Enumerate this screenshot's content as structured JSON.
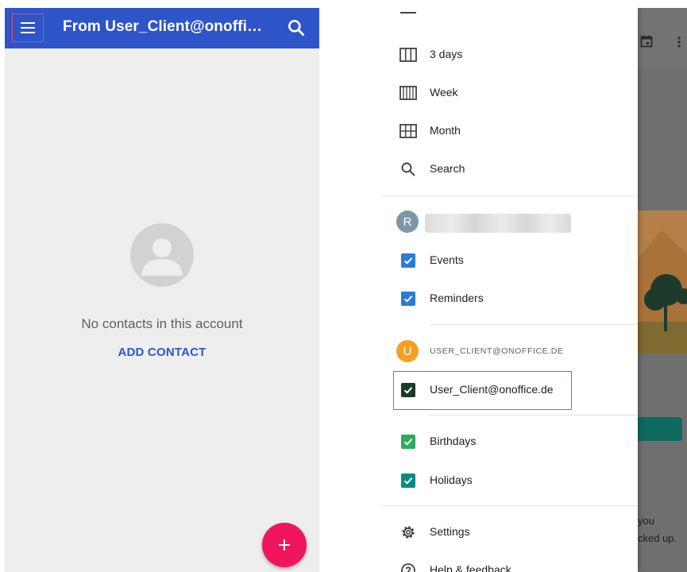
{
  "contacts": {
    "appbar": {
      "title": "From User_Client@onoffic...",
      "menu_icon": "hamburger-menu-icon",
      "search_icon": "search-icon"
    },
    "empty_state": {
      "message": "No contacts in this account",
      "action": "ADD CONTACT",
      "avatar_icon": "person-avatar-icon"
    },
    "fab": {
      "label": "+",
      "icon": "plus-icon"
    }
  },
  "calendar_drawer": {
    "views": [
      {
        "label": "3 days",
        "icon": "three-day-view-icon"
      },
      {
        "label": "Week",
        "icon": "week-view-icon"
      },
      {
        "label": "Month",
        "icon": "month-view-icon"
      },
      {
        "label": "Search",
        "icon": "search-icon"
      }
    ],
    "account_1": {
      "avatar_letter": "R",
      "calendars": [
        {
          "label": "Events",
          "checked": true
        },
        {
          "label": "Reminders",
          "checked": true
        }
      ]
    },
    "account_2": {
      "avatar_letter": "U",
      "header": "USER_CLIENT@ONOFFICE.DE",
      "calendars": [
        {
          "label": "User_Client@onoffice.de",
          "checked": true
        }
      ]
    },
    "other_calendars": [
      {
        "label": "Birthdays",
        "checked": true
      },
      {
        "label": "Holidays",
        "checked": true
      }
    ],
    "footer": [
      {
        "label": "Settings",
        "icon": "gear-icon"
      },
      {
        "label": "Help & feedback",
        "icon": "help-icon"
      }
    ]
  },
  "background": {
    "text_line_1": "you",
    "text_line_2": "cked up."
  },
  "colors": {
    "contacts_appbar": "#2e54c9",
    "fab": "#f0165e",
    "checkbox_blue": "#2a7cd6",
    "checkbox_dark": "#1b3b29",
    "checkbox_green": "#2eab5c",
    "checkbox_teal": "#0c8a84",
    "avatar_r": "#7e97a6",
    "avatar_u": "#f4a020",
    "highlight": "#e04a55"
  }
}
